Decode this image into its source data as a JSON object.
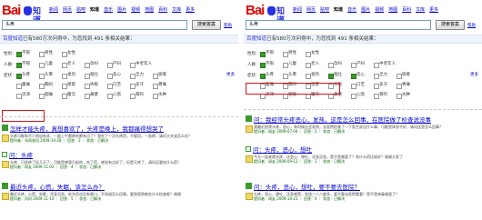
{
  "brand": {
    "logo_text": "Bai",
    "paw_glyph": "du",
    "product": "知道"
  },
  "nav": [
    "新闻",
    "网页",
    "贴吧",
    "知道",
    "音乐",
    "图片",
    "视频",
    "地图",
    "百科",
    "文库",
    "更多"
  ],
  "nav_active_index": 3,
  "search": {
    "query": "头疼",
    "button_label": "搜索答案",
    "help_label": "帮助"
  },
  "stats": {
    "brand": "百度知道",
    "text": "已有580万次问得中，为您找到 491 条相关结果："
  },
  "filters": {
    "row_gender": {
      "label": "性别：",
      "options": [
        "不限",
        "男性",
        "女性"
      ]
    },
    "row_people": {
      "label": "人群：",
      "options": [
        "不限",
        "儿童",
        "老人",
        "孕妇",
        "产妇",
        "中老年人"
      ]
    },
    "row_symptom": {
      "label": "症状：",
      "more": "更多"
    },
    "symptom_row1": [
      "头疼",
      "头晕",
      "发热",
      "呕吐",
      "恶心",
      "乏力",
      "咳嗽"
    ],
    "symptom_row2": [
      "腹痛",
      "胸闷",
      "感冒",
      "失眠",
      "口苦",
      "多汗",
      "胃痛"
    ],
    "symptom_row3": [
      "流涕",
      "咽痛",
      "腹泻",
      "鼻塞",
      "心慌",
      "耳鸣",
      "水肿"
    ]
  },
  "left_results": [
    {
      "type": "tag",
      "title": "怎样才能头疼，真想喜欢了，头疼是晚上，我都痛得想哭了",
      "body": "头疼可能和不少原因有关，一般上午都疼的都有点了？我吃了一点头疼药，不管用，一直疼，请问大夫该怎么办？",
      "meta": "提问者：冰雨香风 2009-10-28 ｜ 回答：3 ｜ 状态：已解决"
    },
    {
      "type": "icon",
      "title": "问：头疼",
      "body": "头疼，已经疼了好几天了，可能是感冒引起的，吃了药，感觉有点好了，但是又疼了，请问还要吃什么药？",
      "meta": "提问者：网友 2009-11-02 ｜ 回答：4 ｜ 状态：已解决"
    },
    {
      "type": "tag",
      "title": "最近头疼，心慌，失眠，该怎么办？",
      "body": "最近头疼，心慌，失眠，浑身没劲，吃东西也没有胃口，不知道怎么回事，要到医院做些什么检查呢？谢谢",
      "meta": "提问者：问问 2009-11-10 ｜ 回答：5 ｜ 状态：已解决"
    }
  ],
  "right_results": [
    {
      "type": "tag",
      "title": "问：我经常头疼恶心，发热，这是怎么回事，在医院做了检查说没事",
      "body": "我最近经常头疼，恶心，有时候还会发热，去医院检查了一下医生说没什么事，可能是休息不好，请问这是怎么回事？",
      "meta": "提问者：网友 2009-07-04 ｜ 回答：2 ｜ 状态：已解决"
    },
    {
      "type": "icon",
      "title": "问：头疼，恶心，想吐",
      "body": "今天一起来就头疼，还恶心，想吐，浑身没劲，是不是感冒了？吃什么药比较好？谢谢大家了",
      "meta": "提问者：网友 2009-09-12 ｜ 回答：3 ｜ 状态：已解决"
    },
    {
      "type": "tag",
      "title": "问：头疼，恶心，想吐，要不要去医院？",
      "body": "头疼，恶心，想吐，浑身难受，发烧三十八度多，要不要去医院看看？是不是病毒感冒了？",
      "meta": "提问者：网友 2009-10-21 ｜ 回答：4 ｜ 状态：已解决"
    }
  ]
}
